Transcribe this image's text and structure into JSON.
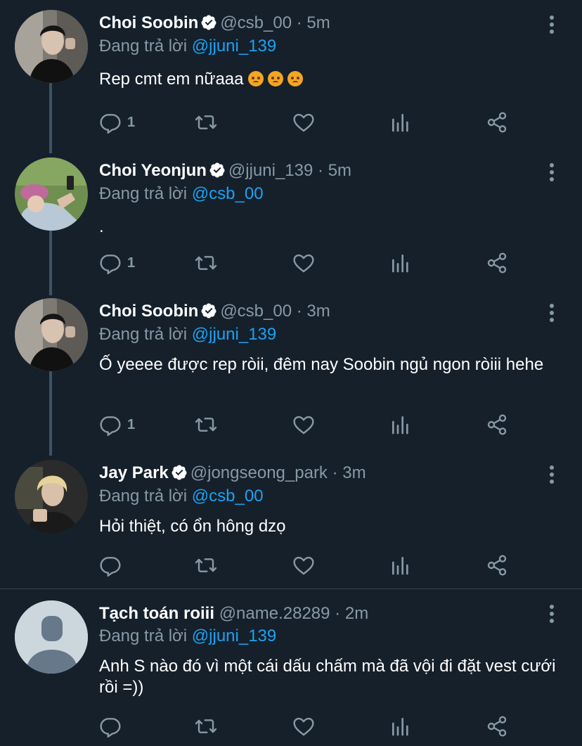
{
  "tweets": [
    {
      "name": "Choi Soobin",
      "verified": true,
      "handle": "@csb_00",
      "time": "5m",
      "replying_label": "Đang trả lời",
      "replying_to": "@jjuni_139",
      "text": "Rep cmt em nữaaa",
      "emojis": [
        "angry-face-emoji",
        "angry-face-emoji",
        "angry-face-emoji"
      ],
      "reply_count": "1",
      "avatar": "soobin-avatar"
    },
    {
      "name": "Choi Yeonjun",
      "verified": true,
      "handle": "@jjuni_139",
      "time": "5m",
      "replying_label": "Đang trả lời",
      "replying_to": "@csb_00",
      "text": ".",
      "reply_count": "1",
      "avatar": "yeonjun-avatar"
    },
    {
      "name": "Choi Soobin",
      "verified": true,
      "handle": "@csb_00",
      "time": "3m",
      "replying_label": "Đang trả lời",
      "replying_to": "@jjuni_139",
      "text": "Ố yeeee được rep ròii, đêm nay Soobin ngủ ngon ròiii hehe",
      "reply_count": "1",
      "avatar": "soobin-avatar"
    },
    {
      "name": "Jay Park",
      "verified": true,
      "handle": "@jongseong_park",
      "time": "3m",
      "replying_label": "Đang trả lời",
      "replying_to": "@csb_00",
      "text": "Hỏi thiệt, có ổn hông dzọ",
      "reply_count": "",
      "avatar": "jaypark-avatar"
    },
    {
      "name": "Tạch toán roiii",
      "verified": false,
      "handle": "@name.28289",
      "time": "2m",
      "replying_label": "Đang trả lời",
      "replying_to": "@jjuni_139",
      "text": "Anh S nào đó vì một cái dấu chấm mà đã vội đi đặt vest cưới rồi =))",
      "reply_count": "",
      "avatar": "default-avatar"
    }
  ],
  "separator": "·",
  "colors": {
    "background": "#15202b",
    "secondary_text": "#8899a6",
    "link": "#1da1f2",
    "thread_line": "#3d5466",
    "divider": "#38444d"
  },
  "icons": [
    "reply-icon",
    "retweet-icon",
    "like-icon",
    "analytics-icon",
    "share-icon",
    "more-icon",
    "verified-badge-icon"
  ]
}
